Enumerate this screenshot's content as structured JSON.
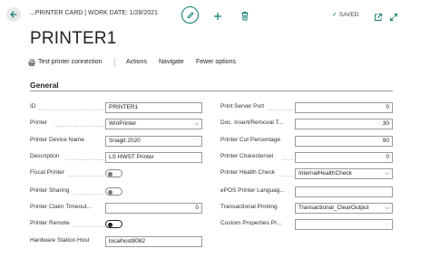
{
  "header": {
    "breadcrumb": "...PRINTER CARD | WORK DATE: 1/28/2021",
    "saved_label": "SAVED",
    "saved_check": "✓"
  },
  "page": {
    "title": "PRINTER1"
  },
  "actions": {
    "test": "Test printer connection",
    "actions": "Actions",
    "navigate": "Navigate",
    "fewer": "Fewer options"
  },
  "section": {
    "title": "General"
  },
  "left_fields": {
    "id": {
      "label": "ID",
      "value": "PRINTER1"
    },
    "printer": {
      "label": "Printer",
      "value": "WinPrinter"
    },
    "device_name": {
      "label": "Printer Device Name",
      "value": "Snagit 2020"
    },
    "description": {
      "label": "Description",
      "value": "LS HWST Printer"
    },
    "fiscal": {
      "label": "Fiscal Printer",
      "on": false
    },
    "sharing": {
      "label": "Printer Sharing",
      "on": false
    },
    "claim_timeout": {
      "label": "Printer Claim Timeout...",
      "value": "0"
    },
    "remote": {
      "label": "Printer Remote",
      "on": true
    },
    "host": {
      "label": "Hardware Station Host",
      "value": "localhost8082"
    }
  },
  "right_fields": {
    "server_port": {
      "label": "Print Server Port",
      "value": "0"
    },
    "doc_insert": {
      "label": "Doc. Insert/Removal T...",
      "value": "30"
    },
    "cut_pct": {
      "label": "Printer Cut Percentage",
      "value": "90"
    },
    "charset": {
      "label": "Printer Charecterset",
      "value": "0"
    },
    "health_check": {
      "label": "Printer Health Check",
      "value": "InternalHealthCheck"
    },
    "epos_lang": {
      "label": "ePOS Printer Languag...",
      "value": ""
    },
    "trans_print": {
      "label": "Transactional Printing",
      "value": "Transactional_ClearOutput"
    },
    "custom_props": {
      "label": "Custom Properties Pr...",
      "value": ""
    }
  },
  "colors": {
    "accent": "#0a7b6f"
  },
  "icons": {
    "back": "back-arrow-icon",
    "edit": "pencil-icon",
    "add": "plus-icon",
    "delete": "trash-icon",
    "open_new": "open-in-new-window-icon",
    "expand": "expand-icon",
    "test": "printer-test-icon"
  }
}
